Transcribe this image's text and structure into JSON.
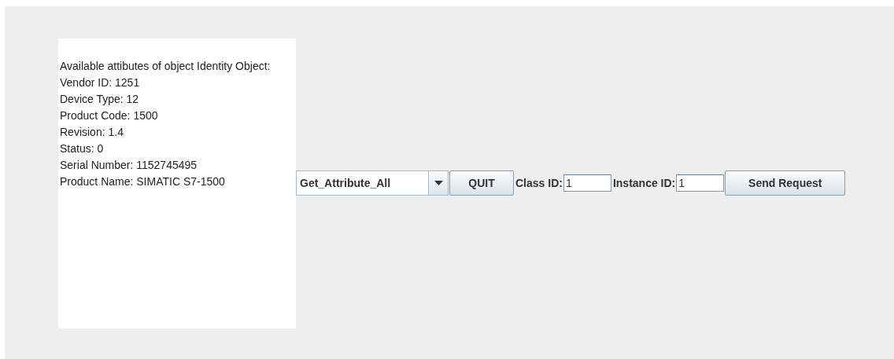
{
  "output_lines": [
    "Available attibutes of object Identity Object:",
    "Vendor ID: 1251",
    "Device Type: 12",
    "Product Code: 1500",
    "Revision: 1.4",
    "Status: 0",
    "Serial Number: 1152745495",
    "Product Name: SIMATIC S7-1500"
  ],
  "service_dropdown": {
    "value": "Get_Attribute_All"
  },
  "quit_button": "QUIT",
  "class_id": {
    "label": "Class ID:",
    "value": "1"
  },
  "instance_id": {
    "label": "Instance ID:",
    "value": "1"
  },
  "send_button": "Send Request"
}
